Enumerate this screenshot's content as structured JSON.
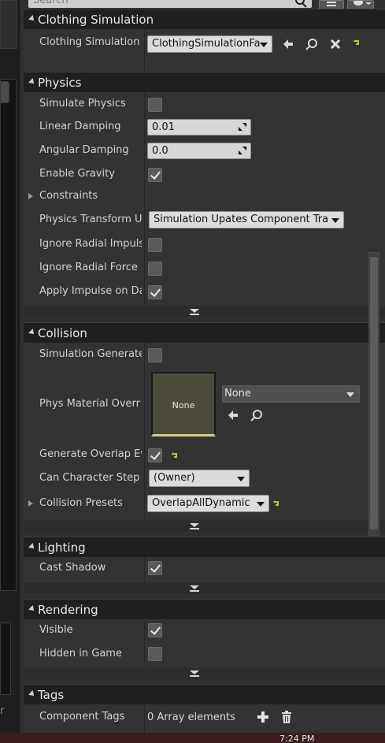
{
  "search": {
    "placeholder": "Search"
  },
  "clothing": {
    "title": "Clothing Simulation",
    "label": "Clothing Simulation",
    "value": "ClothingSimulationFa"
  },
  "physics": {
    "title": "Physics",
    "simulate_physics": "Simulate Physics",
    "linear_damping": "Linear Damping",
    "linear_damping_value": "0.01",
    "angular_damping": "Angular Damping",
    "angular_damping_value": "0.0",
    "enable_gravity": "Enable Gravity",
    "constraints": "Constraints",
    "physics_transform": "Physics Transform U",
    "physics_transform_value": "Simulation Upates Component Tra",
    "ignore_radial_impulse": "Ignore Radial Impuls",
    "ignore_radial_force": "Ignore Radial Force",
    "apply_impulse": "Apply Impulse on Da"
  },
  "collision": {
    "title": "Collision",
    "simulation_generates": "Simulation Generate",
    "phys_material": "Phys Material Overr",
    "thumb_text": "None",
    "material_value": "None",
    "generate_overlap": "Generate Overlap Ev",
    "can_character_step": "Can Character Step",
    "can_character_step_value": "(Owner)",
    "collision_presets": "Collision Presets",
    "collision_presets_value": "OverlapAllDynamic"
  },
  "lighting": {
    "title": "Lighting",
    "cast_shadow": "Cast Shadow"
  },
  "rendering": {
    "title": "Rendering",
    "visible": "Visible",
    "hidden_in_game": "Hidden in Game"
  },
  "tags": {
    "title": "Tags",
    "component_tags": "Component Tags",
    "component_tags_value": "0 Array elements"
  },
  "left_panel": {
    "partial_text": "r"
  },
  "taskbar": {
    "clock": "7:24 PM"
  },
  "checks": {
    "simulate_physics": false,
    "enable_gravity": true,
    "ignore_radial_impulse": false,
    "ignore_radial_force": false,
    "apply_impulse": true,
    "simulation_generates": false,
    "generate_overlap": true,
    "cast_shadow": true,
    "visible": true,
    "hidden_in_game": false
  },
  "colors": {
    "panel": "#303030",
    "header": "#1f1f1f",
    "material_thumb": "#4d4a3a",
    "reset_arrow": "#c8c030",
    "taskbar": "#3a1c1c"
  }
}
